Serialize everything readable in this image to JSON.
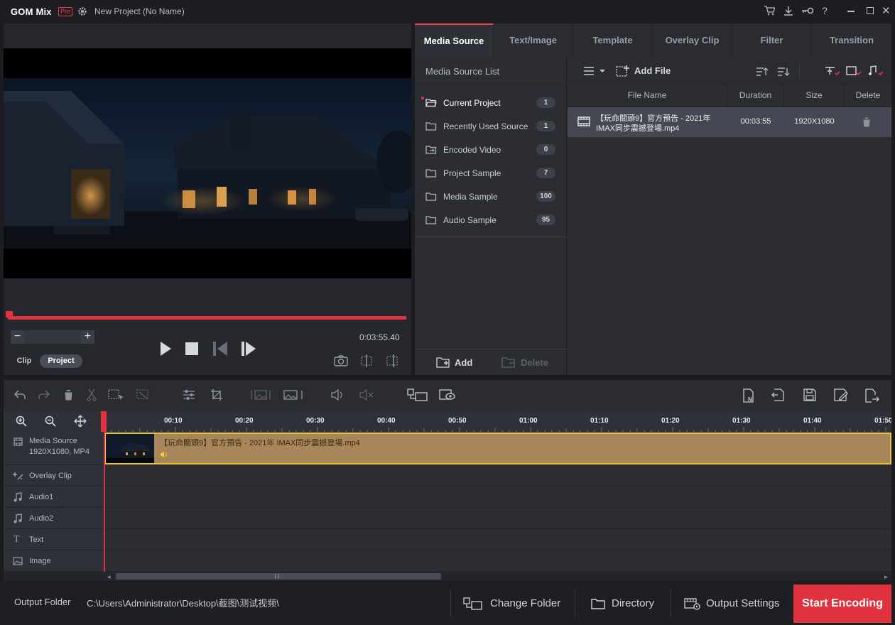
{
  "app": {
    "logo": "GOM Mix",
    "badge": "Pro",
    "title": "New Project (No Name)"
  },
  "preview": {
    "timecode": "0:03:55.40",
    "modes": [
      "Clip",
      "Project"
    ],
    "active_mode": "Project"
  },
  "tabs": [
    {
      "label": "Media Source",
      "active": true
    },
    {
      "label": "Text/Image",
      "active": false
    },
    {
      "label": "Template",
      "active": false
    },
    {
      "label": "Overlay Clip",
      "active": false
    },
    {
      "label": "Filter",
      "active": false
    },
    {
      "label": "Transition",
      "active": false
    }
  ],
  "media_source": {
    "list_title": "Media Source List",
    "add_file": "Add File",
    "tree": [
      {
        "label": "Current Project",
        "count": "1"
      },
      {
        "label": "Recently Used Source",
        "count": "1"
      },
      {
        "label": "Encoded Video",
        "count": "0"
      },
      {
        "label": "Project Sample",
        "count": "7"
      },
      {
        "label": "Media Sample",
        "count": "100"
      },
      {
        "label": "Audio Sample",
        "count": "95"
      }
    ],
    "add_button": "Add",
    "delete_button": "Delete",
    "columns": [
      "File Name",
      "Duration",
      "Size",
      "Delete"
    ],
    "files": [
      {
        "name_line1": "【玩命關頭9】官方預告 - 2021年",
        "name_line2": "IMAX同步震撼登場.mp4",
        "duration": "00:03:55",
        "size": "1920X1080"
      }
    ]
  },
  "timeline": {
    "ticks": [
      "00:10",
      "00:20",
      "00:30",
      "00:40",
      "00:50",
      "01:00",
      "01:10",
      "01:20",
      "01:30",
      "01:40",
      "01:50"
    ],
    "tracks": [
      {
        "label": "Media Source",
        "sub": "1920X1080, MP4"
      },
      {
        "label": "Overlay Clip",
        "sub": ""
      },
      {
        "label": "Audio1",
        "sub": ""
      },
      {
        "label": "Audio2",
        "sub": ""
      },
      {
        "label": "Text",
        "sub": ""
      },
      {
        "label": "Image",
        "sub": ""
      }
    ],
    "clip_title": "【玩命關頭9】官方預告 - 2021年 IMAX同步震撼登場.mp4"
  },
  "bottom": {
    "output_folder_label": "Output Folder",
    "output_path": "C:\\Users\\Administrator\\Desktop\\截图\\测试视频\\",
    "change_folder": "Change Folder",
    "directory": "Directory",
    "output_settings": "Output Settings",
    "start_encoding": "Start Encoding"
  },
  "colors": {
    "accent": "#e0323f",
    "clip": "#a8865a",
    "clip_border": "#e8c23a"
  }
}
